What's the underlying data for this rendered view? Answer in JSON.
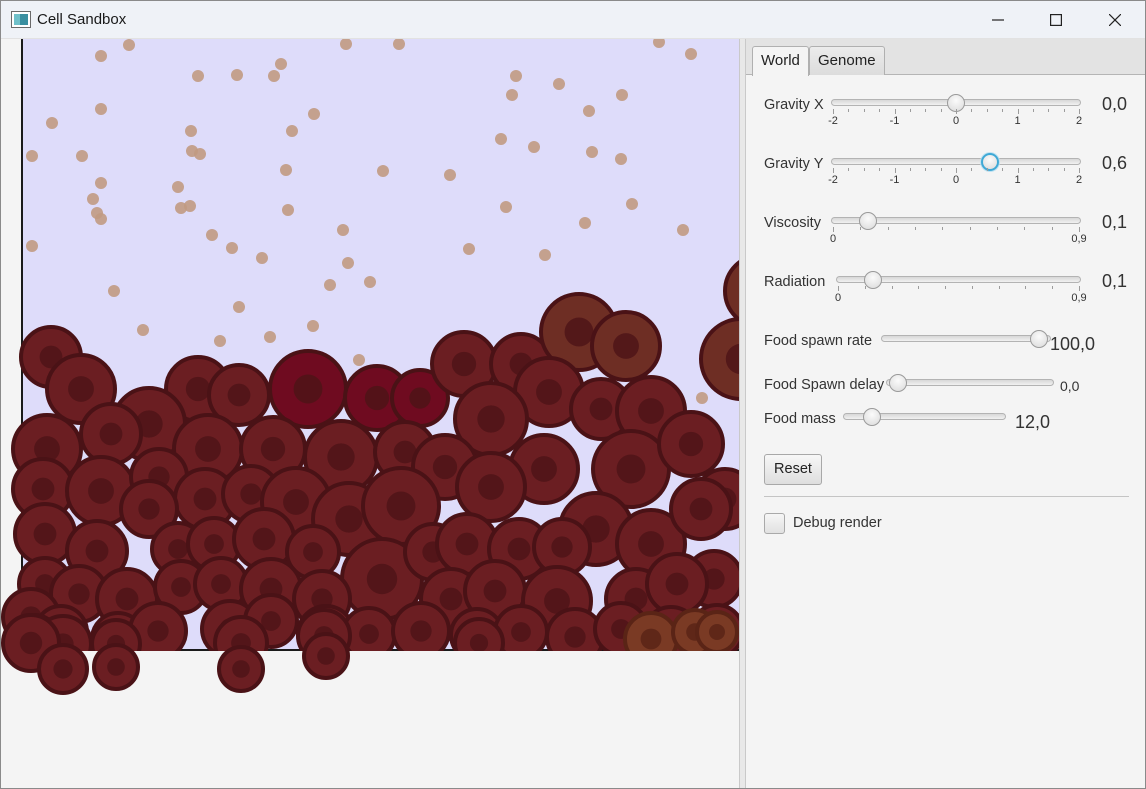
{
  "window": {
    "title": "Cell Sandbox",
    "icon": "app-window-icon",
    "controls": [
      "minimize-icon",
      "maximize-icon",
      "close-icon"
    ]
  },
  "tabs": [
    {
      "label": "World",
      "selected": true
    },
    {
      "label": "Genome",
      "selected": false
    }
  ],
  "sliders": {
    "gravity_x": {
      "label": "Gravity X",
      "value": "0,0",
      "min": -2,
      "max": 2,
      "current": 0,
      "tick_labels": [
        "-2",
        "-1",
        "0",
        "1",
        "2"
      ]
    },
    "gravity_y": {
      "label": "Gravity Y",
      "value": "0,6",
      "min": -2,
      "max": 2,
      "current": 0.6,
      "focused": true,
      "tick_labels": [
        "-2",
        "-1",
        "0",
        "1",
        "2"
      ]
    },
    "viscosity": {
      "label": "Viscosity",
      "value": "0,1",
      "min": 0,
      "max": 0.9,
      "current": 0.1,
      "tick_labels": [
        "0",
        "0,9"
      ]
    },
    "radiation": {
      "label": "Radiation",
      "value": "0,1",
      "min": 0,
      "max": 0.9,
      "current": 0.1,
      "tick_labels": [
        "0",
        "0,9"
      ]
    },
    "food_spawn_rate": {
      "label": "Food spawn rate",
      "value": "100,0",
      "min": 0,
      "max": 100,
      "current": 100
    },
    "food_spawn_delay": {
      "label": "Food Spawn delay",
      "value": "0,0",
      "min": 0,
      "max": 100,
      "current": 0
    },
    "food_mass": {
      "label": "Food mass",
      "value": "12,0",
      "min": 0,
      "max": 100,
      "current": 12
    }
  },
  "reset_label": "Reset",
  "debug_render": {
    "label": "Debug render",
    "checked": false
  },
  "colors": {
    "world_background": "#dedcfa",
    "food_particle": "#c19a82",
    "cell_fill": "#6b1e22",
    "cell_border": "#4a1216",
    "cell_nucleus": "#4f1418",
    "highlight_cell": "#6f0b20",
    "accent_focus": "#3fa9d6"
  }
}
